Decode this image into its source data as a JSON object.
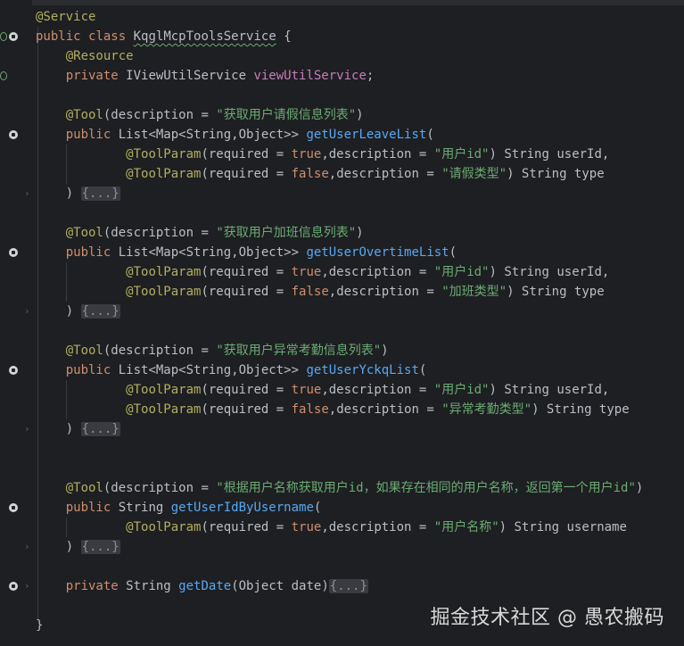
{
  "editor": {
    "lines": [
      {
        "tokens": [
          {
            "t": "@Service",
            "c": "ann"
          }
        ]
      },
      {
        "tokens": [
          {
            "t": "public",
            "c": "kw"
          },
          {
            "t": " "
          },
          {
            "t": "class",
            "c": "kw"
          },
          {
            "t": " "
          },
          {
            "t": "KqglMcpToolsService",
            "c": "cls",
            "sq": true
          },
          {
            "t": " {"
          }
        ]
      },
      {
        "tokens": [
          {
            "t": "    "
          },
          {
            "t": "@Resource",
            "c": "ann"
          }
        ]
      },
      {
        "tokens": [
          {
            "t": "    "
          },
          {
            "t": "private",
            "c": "kw"
          },
          {
            "t": " IViewUtilService "
          },
          {
            "t": "viewUtilService",
            "c": "fld"
          },
          {
            "t": ";"
          }
        ]
      },
      {
        "tokens": []
      },
      {
        "tokens": [
          {
            "t": "    "
          },
          {
            "t": "@Tool",
            "c": "ann"
          },
          {
            "t": "(description = "
          },
          {
            "t": "\"获取用户请假信息列表\"",
            "c": "str"
          },
          {
            "t": ")"
          }
        ]
      },
      {
        "tokens": [
          {
            "t": "    "
          },
          {
            "t": "public",
            "c": "kw"
          },
          {
            "t": " List<Map<String,Object>> "
          },
          {
            "t": "getUserLeaveList",
            "c": "def"
          },
          {
            "t": "("
          }
        ]
      },
      {
        "tokens": [
          {
            "t": "            "
          },
          {
            "t": "@ToolParam",
            "c": "ann"
          },
          {
            "t": "(required = "
          },
          {
            "t": "true",
            "c": "kw"
          },
          {
            "t": ",description = "
          },
          {
            "t": "\"用户id\"",
            "c": "str"
          },
          {
            "t": ") String userId,"
          }
        ]
      },
      {
        "tokens": [
          {
            "t": "            "
          },
          {
            "t": "@ToolParam",
            "c": "ann"
          },
          {
            "t": "(required = "
          },
          {
            "t": "false",
            "c": "kw"
          },
          {
            "t": ",description = "
          },
          {
            "t": "\"请假类型\"",
            "c": "str"
          },
          {
            "t": ") String type"
          }
        ]
      },
      {
        "tokens": [
          {
            "t": "    ) "
          },
          {
            "t": "{...}",
            "c": "fold"
          }
        ]
      },
      {
        "tokens": []
      },
      {
        "tokens": [
          {
            "t": "    "
          },
          {
            "t": "@Tool",
            "c": "ann"
          },
          {
            "t": "(description = "
          },
          {
            "t": "\"获取用户加班信息列表\"",
            "c": "str"
          },
          {
            "t": ")"
          }
        ]
      },
      {
        "tokens": [
          {
            "t": "    "
          },
          {
            "t": "public",
            "c": "kw"
          },
          {
            "t": " List<Map<String,Object>> "
          },
          {
            "t": "getUserOvertimeList",
            "c": "def"
          },
          {
            "t": "("
          }
        ]
      },
      {
        "tokens": [
          {
            "t": "            "
          },
          {
            "t": "@ToolParam",
            "c": "ann"
          },
          {
            "t": "(required = "
          },
          {
            "t": "true",
            "c": "kw"
          },
          {
            "t": ",description = "
          },
          {
            "t": "\"用户id\"",
            "c": "str"
          },
          {
            "t": ") String userId,"
          }
        ]
      },
      {
        "tokens": [
          {
            "t": "            "
          },
          {
            "t": "@ToolParam",
            "c": "ann"
          },
          {
            "t": "(required = "
          },
          {
            "t": "false",
            "c": "kw"
          },
          {
            "t": ",description = "
          },
          {
            "t": "\"加班类型\"",
            "c": "str"
          },
          {
            "t": ") String type"
          }
        ]
      },
      {
        "tokens": [
          {
            "t": "    ) "
          },
          {
            "t": "{...}",
            "c": "fold"
          }
        ]
      },
      {
        "tokens": []
      },
      {
        "tokens": [
          {
            "t": "    "
          },
          {
            "t": "@Tool",
            "c": "ann"
          },
          {
            "t": "(description = "
          },
          {
            "t": "\"获取用户异常考勤信息列表\"",
            "c": "str"
          },
          {
            "t": ")"
          }
        ]
      },
      {
        "tokens": [
          {
            "t": "    "
          },
          {
            "t": "public",
            "c": "kw"
          },
          {
            "t": " List<Map<String,Object>> "
          },
          {
            "t": "getUserYckqList",
            "c": "def"
          },
          {
            "t": "("
          }
        ]
      },
      {
        "tokens": [
          {
            "t": "            "
          },
          {
            "t": "@ToolParam",
            "c": "ann"
          },
          {
            "t": "(required = "
          },
          {
            "t": "true",
            "c": "kw"
          },
          {
            "t": ",description = "
          },
          {
            "t": "\"用户id\"",
            "c": "str"
          },
          {
            "t": ") String userId,"
          }
        ]
      },
      {
        "tokens": [
          {
            "t": "            "
          },
          {
            "t": "@ToolParam",
            "c": "ann"
          },
          {
            "t": "(required = "
          },
          {
            "t": "false",
            "c": "kw"
          },
          {
            "t": ",description = "
          },
          {
            "t": "\"异常考勤类型\"",
            "c": "str"
          },
          {
            "t": ") String type"
          }
        ]
      },
      {
        "tokens": [
          {
            "t": "    ) "
          },
          {
            "t": "{...}",
            "c": "fold"
          }
        ]
      },
      {
        "tokens": []
      },
      {
        "tokens": []
      },
      {
        "tokens": [
          {
            "t": "    "
          },
          {
            "t": "@Tool",
            "c": "ann"
          },
          {
            "t": "(description = "
          },
          {
            "t": "\"根据用户名称获取用户id，如果存在相同的用户名称，返回第一个用户id\"",
            "c": "str"
          },
          {
            "t": ")"
          }
        ]
      },
      {
        "tokens": [
          {
            "t": "    "
          },
          {
            "t": "public",
            "c": "kw"
          },
          {
            "t": " String "
          },
          {
            "t": "getUserIdByUsername",
            "c": "def"
          },
          {
            "t": "("
          }
        ]
      },
      {
        "tokens": [
          {
            "t": "            "
          },
          {
            "t": "@ToolParam",
            "c": "ann"
          },
          {
            "t": "(required = "
          },
          {
            "t": "true",
            "c": "kw"
          },
          {
            "t": ",description = "
          },
          {
            "t": "\"用户名称\"",
            "c": "str"
          },
          {
            "t": ") String username"
          }
        ]
      },
      {
        "tokens": [
          {
            "t": "    ) "
          },
          {
            "t": "{...}",
            "c": "fold"
          }
        ]
      },
      {
        "tokens": []
      },
      {
        "tokens": [
          {
            "t": "    "
          },
          {
            "t": "private",
            "c": "kw"
          },
          {
            "t": " String "
          },
          {
            "t": "getDate",
            "c": "def"
          },
          {
            "t": "(Object date)"
          },
          {
            "t": "{...}",
            "c": "fold"
          }
        ]
      },
      {
        "tokens": []
      },
      {
        "tokens": [
          {
            "t": "}"
          }
        ]
      }
    ]
  },
  "watermark": "掘金技术社区 @ 愚农搬码",
  "colors": {
    "background": "#1e1f22",
    "keyword": "#cf8e6d",
    "annotation": "#b3ae60",
    "string": "#6aab73",
    "method": "#56a8f5",
    "field": "#c77dbb",
    "text": "#bcbec4"
  }
}
